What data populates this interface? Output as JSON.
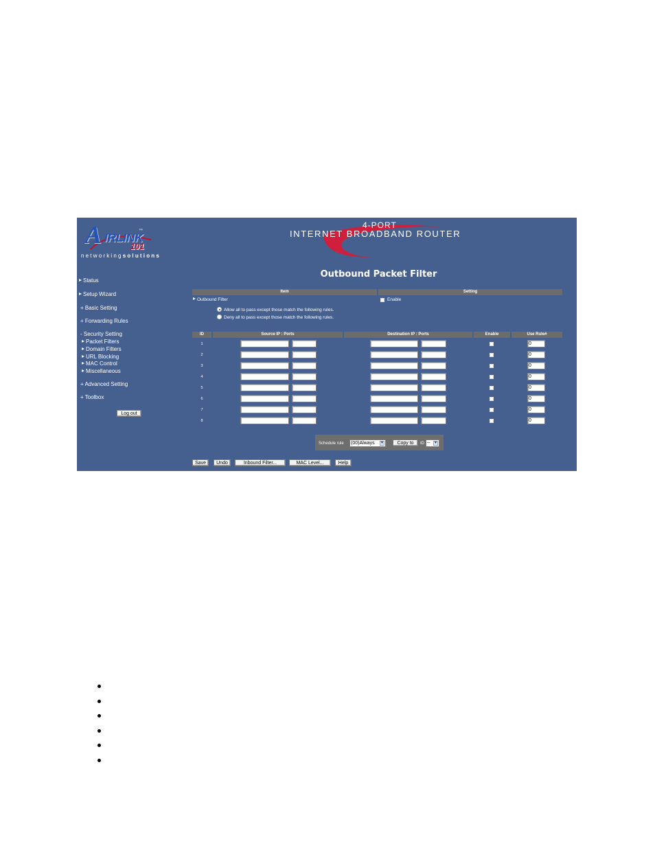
{
  "logo": {
    "letter_a": "A",
    "letters": "IRLINK",
    "tm": "™",
    "number": "101",
    "tagline_light": "networking",
    "tagline_bold": "solutions"
  },
  "banner": {
    "subtitle": "4-PORT",
    "title": "INTERNET BROADBAND ROUTER"
  },
  "nav": {
    "status": "Status",
    "setup_wizard": "Setup Wizard",
    "basic_setting": "+ Basic Setting",
    "forwarding_rules": "+ Forwarding Rules",
    "security_setting": "- Security Setting",
    "packet_filters": "Packet Filters",
    "domain_filters": "Domain Filters",
    "url_blocking": "URL Blocking",
    "mac_control": "MAC Control",
    "miscellaneous": "Miscellaneous",
    "advanced_setting": "+ Advanced Setting",
    "toolbox": "+ Toolbox",
    "logout": "Log out"
  },
  "page": {
    "title": "Outbound Packet Filter"
  },
  "settings_table": {
    "header_item": "Item",
    "header_setting": "Setting",
    "outbound_filter_label": "Outbound Filter",
    "enable_label": "Enable",
    "option_allow": "Allow all to pass except those match the following rules.",
    "option_deny": "Deny all to pass except those match the following rules.",
    "selected_option": "allow"
  },
  "rules_table": {
    "headers": {
      "id": "ID",
      "source": "Source IP : Ports",
      "destination": "Destination IP : Ports",
      "enable": "Enable",
      "use_rule": "Use Rule#"
    },
    "rows": [
      {
        "id": "1",
        "src_ip": "",
        "src_port": "",
        "dst_ip": "",
        "dst_port": "",
        "enabled": false,
        "use_rule": "0"
      },
      {
        "id": "2",
        "src_ip": "",
        "src_port": "",
        "dst_ip": "",
        "dst_port": "",
        "enabled": false,
        "use_rule": "0"
      },
      {
        "id": "3",
        "src_ip": "",
        "src_port": "",
        "dst_ip": "",
        "dst_port": "",
        "enabled": false,
        "use_rule": "0"
      },
      {
        "id": "4",
        "src_ip": "",
        "src_port": "",
        "dst_ip": "",
        "dst_port": "",
        "enabled": false,
        "use_rule": "0"
      },
      {
        "id": "5",
        "src_ip": "",
        "src_port": "",
        "dst_ip": "",
        "dst_port": "",
        "enabled": false,
        "use_rule": "0"
      },
      {
        "id": "6",
        "src_ip": "",
        "src_port": "",
        "dst_ip": "",
        "dst_port": "",
        "enabled": false,
        "use_rule": "0"
      },
      {
        "id": "7",
        "src_ip": "",
        "src_port": "",
        "dst_ip": "",
        "dst_port": "",
        "enabled": false,
        "use_rule": "0"
      },
      {
        "id": "8",
        "src_ip": "",
        "src_port": "",
        "dst_ip": "",
        "dst_port": "",
        "enabled": false,
        "use_rule": "0"
      }
    ]
  },
  "schedule": {
    "label": "Schedule rule",
    "selected": "(00)Always",
    "copy_button": "Copy to",
    "id_label": "ID",
    "id_selected": "--"
  },
  "actions": {
    "save": "Save",
    "undo": "Undo",
    "inbound": "Inbound Filter...",
    "mac_level": "MAC Level...",
    "help": "Help"
  },
  "colors": {
    "panel_bg": "#45608f",
    "header_bg": "#6c6c6c",
    "logo_blue": "#2353b8",
    "logo_red": "#c8102e",
    "swoosh_red": "#d01f3c"
  }
}
